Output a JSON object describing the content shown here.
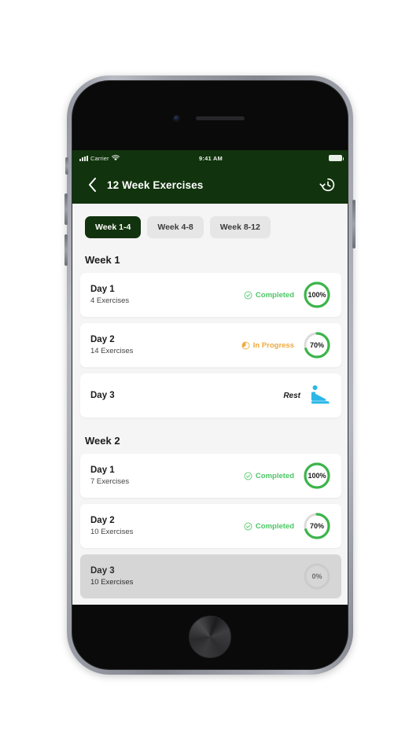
{
  "device": {
    "frame": "iphone-8",
    "body_color": "#8e9199"
  },
  "statusbar": {
    "carrier": "Carrier",
    "time": "9:41 AM",
    "signal_icon": "signal-bars-icon",
    "wifi_icon": "wifi-icon",
    "battery_icon": "battery-full-icon"
  },
  "navbar": {
    "back_icon": "chevron-left-icon",
    "title": "12 Week Exercises",
    "history_icon": "history-icon",
    "background": "#11330d"
  },
  "tabs": [
    {
      "label": "Week 1-4",
      "active": true
    },
    {
      "label": "Week 4-8",
      "active": false
    },
    {
      "label": "Week 8-12",
      "active": false
    }
  ],
  "colors": {
    "primary_green": "#11330d",
    "completed_green": "#4cc764",
    "in_progress_orange": "#efa93c",
    "rest_blue": "#2ab7e8",
    "ring_track": "#dcdcdc",
    "page_background": "#f5f5f5",
    "disabled_card": "#d6d6d6"
  },
  "sections": [
    {
      "heading": "Week 1",
      "days": [
        {
          "title": "Day 1",
          "subtitle": "4 Exercises",
          "status_label": "Completed",
          "status_type": "completed",
          "status_icon": "check-circle-icon",
          "percent": 100,
          "percent_label": "100%",
          "disabled": false,
          "rest": false
        },
        {
          "title": "Day 2",
          "subtitle": "14 Exercises",
          "status_label": "In Progress",
          "status_type": "inprogress",
          "status_icon": "pie-progress-icon",
          "percent": 70,
          "percent_label": "70%",
          "disabled": false,
          "rest": false
        },
        {
          "title": "Day 3",
          "subtitle": "",
          "status_label": "Rest",
          "status_type": "rest",
          "status_icon": "reclining-seat-icon",
          "percent": null,
          "percent_label": "",
          "disabled": false,
          "rest": true
        }
      ]
    },
    {
      "heading": "Week 2",
      "days": [
        {
          "title": "Day 1",
          "subtitle": "7 Exercises",
          "status_label": "Completed",
          "status_type": "completed",
          "status_icon": "check-circle-icon",
          "percent": 100,
          "percent_label": "100%",
          "disabled": false,
          "rest": false
        },
        {
          "title": "Day 2",
          "subtitle": "10 Exercises",
          "status_label": "Completed",
          "status_type": "completed",
          "status_icon": "check-circle-icon",
          "percent": 70,
          "percent_label": "70%",
          "disabled": false,
          "rest": false
        },
        {
          "title": "Day 3",
          "subtitle": "10 Exercises",
          "status_label": "",
          "status_type": "none",
          "status_icon": "",
          "percent": 0,
          "percent_label": "0%",
          "disabled": true,
          "rest": false
        }
      ]
    }
  ]
}
